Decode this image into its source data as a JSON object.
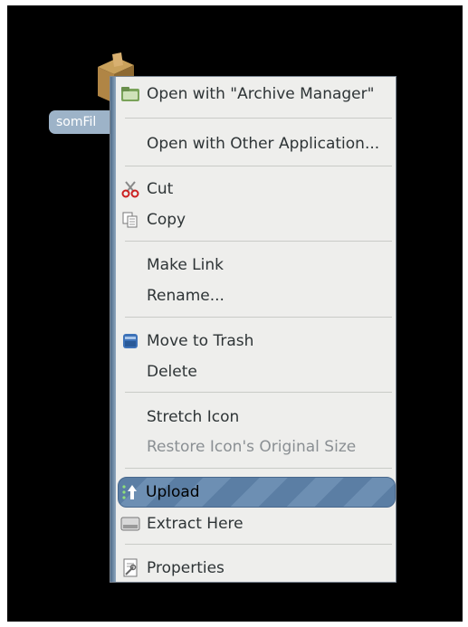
{
  "desktop": {
    "file_label": "somFil"
  },
  "menu": {
    "items": [
      {
        "label": "Open with \"Archive Manager\"",
        "icon": "archive-manager-icon"
      },
      {
        "label": "Open with Other Application..."
      },
      {
        "label": "Cut",
        "icon": "scissors-icon"
      },
      {
        "label": "Copy",
        "icon": "copy-icon"
      },
      {
        "label": "Make Link"
      },
      {
        "label": "Rename..."
      },
      {
        "label": "Move to Trash",
        "icon": "trash-icon"
      },
      {
        "label": "Delete"
      },
      {
        "label": "Stretch Icon"
      },
      {
        "label": "Restore Icon's Original Size",
        "disabled": true
      },
      {
        "label": "Upload",
        "icon": "upload-icon",
        "highlighted": true
      },
      {
        "label": "Extract Here",
        "icon": "extract-icon"
      },
      {
        "label": "Properties",
        "icon": "properties-icon"
      }
    ]
  },
  "colors": {
    "menu_background": "#eeeeec",
    "highlight": "#5b7ea4",
    "desktop": "#000000",
    "label_background": "#9db3c8"
  }
}
